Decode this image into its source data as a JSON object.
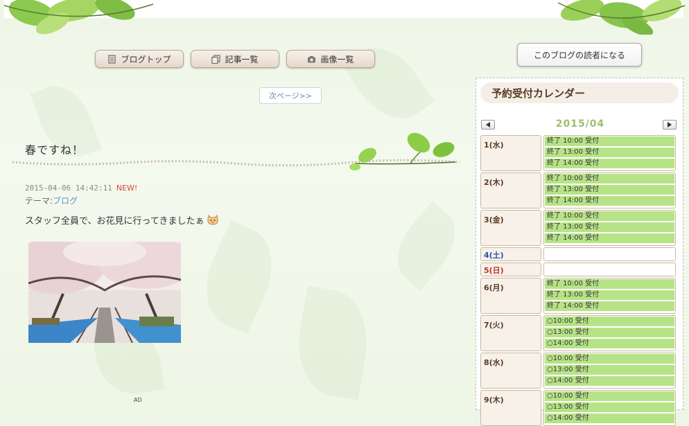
{
  "nav": {
    "blog_top": "ブログトップ",
    "articles": "記事一覧",
    "images": "画像一覧"
  },
  "pager": {
    "next": "次ページ>>"
  },
  "post": {
    "title": "春ですね！",
    "date": "2015-04-06 14:42:11",
    "new_label": "NEW!",
    "theme_label": "テーマ:",
    "theme_link": "ブログ",
    "body": "スタッフ全員で、お花見に行ってきましたぁ"
  },
  "ad_label": "AD",
  "sidebar": {
    "reader_button": "このブログの読者になる",
    "calendar": {
      "title": "予約受付カレンダー",
      "month": "2015/04",
      "days": [
        {
          "label": "1(水)",
          "type": "weekday",
          "slots": [
            "終了 10:00 受付",
            "終了 13:00 受付",
            "終了 14:00 受付"
          ]
        },
        {
          "label": "2(木)",
          "type": "weekday",
          "slots": [
            "終了 10:00 受付",
            "終了 13:00 受付",
            "終了 14:00 受付"
          ]
        },
        {
          "label": "3(金)",
          "type": "weekday",
          "slots": [
            "終了 10:00 受付",
            "終了 13:00 受付",
            "終了 14:00 受付"
          ]
        },
        {
          "label": "4(土)",
          "type": "sat",
          "slots": []
        },
        {
          "label": "5(日)",
          "type": "sun",
          "slots": []
        },
        {
          "label": "6(月)",
          "type": "weekday",
          "slots": [
            "終了 10:00 受付",
            "終了 13:00 受付",
            "終了 14:00 受付"
          ]
        },
        {
          "label": "7(火)",
          "type": "weekday",
          "slots": [
            "○10:00 受付",
            "○13:00 受付",
            "○14:00 受付"
          ]
        },
        {
          "label": "8(水)",
          "type": "weekday",
          "slots": [
            "○10:00 受付",
            "○13:00 受付",
            "○14:00 受付"
          ]
        },
        {
          "label": "9(木)",
          "type": "weekday",
          "slots": [
            "○10:00 受付",
            "○13:00 受付",
            "○14:00 受付"
          ]
        }
      ]
    }
  }
}
